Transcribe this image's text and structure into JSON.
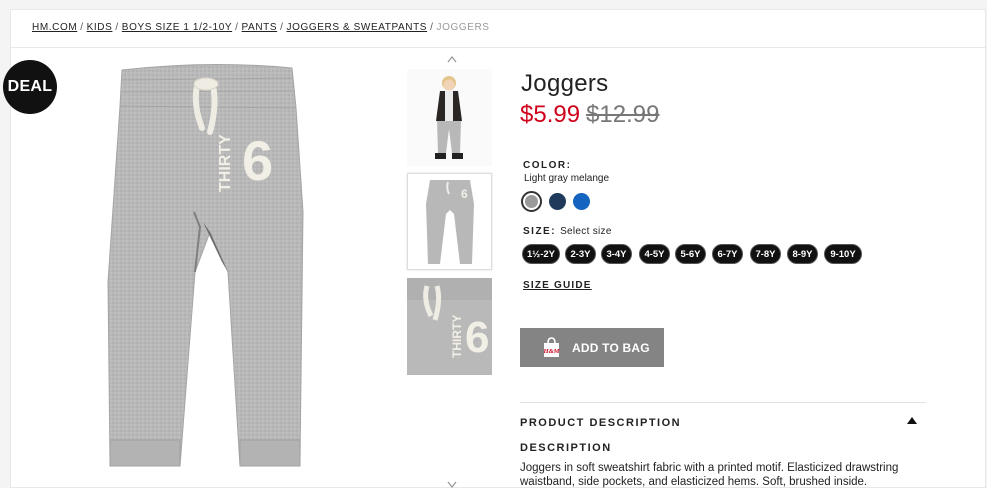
{
  "breadcrumb": {
    "items": [
      "HM.COM",
      "KIDS",
      "BOYS SIZE 1 1/2-10Y",
      "PANTS",
      "JOGGERS & SWEATPANTS"
    ],
    "separator": "/",
    "current": "JOGGERS"
  },
  "badge": {
    "label": "DEAL"
  },
  "product": {
    "title": "Joggers",
    "sale_price": "$5.99",
    "original_price": "$12.99",
    "print_text": "THIRTY",
    "print_number": "6"
  },
  "color": {
    "label": "COLOR:",
    "selected_name": "Light gray melange",
    "swatches": [
      {
        "name": "light-gray",
        "hex": "#9a9a9a",
        "selected": true
      },
      {
        "name": "dark-blue",
        "hex": "#1f3a5a",
        "selected": false
      },
      {
        "name": "blue",
        "hex": "#1565c0",
        "selected": false
      }
    ]
  },
  "size": {
    "label": "SIZE:",
    "prompt": "Select size",
    "options": [
      "1½-2Y",
      "2-3Y",
      "3-4Y",
      "4-5Y",
      "5-6Y",
      "6-7Y",
      "7-8Y",
      "8-9Y",
      "9-10Y"
    ]
  },
  "size_guide": "SIZE GUIDE",
  "add_to_bag": {
    "label": "ADD TO BAG",
    "bag_logo": "H&M"
  },
  "description_section": {
    "header": "PRODUCT DESCRIPTION",
    "label": "DESCRIPTION",
    "text": "Joggers in soft sweatshirt fabric with a printed motif. Elasticized drawstring waistband, side pockets, and elasticized hems. Soft, brushed inside."
  },
  "colors": {
    "sale": "#d0021b",
    "button": "#848484",
    "size_pill": "#111111"
  }
}
